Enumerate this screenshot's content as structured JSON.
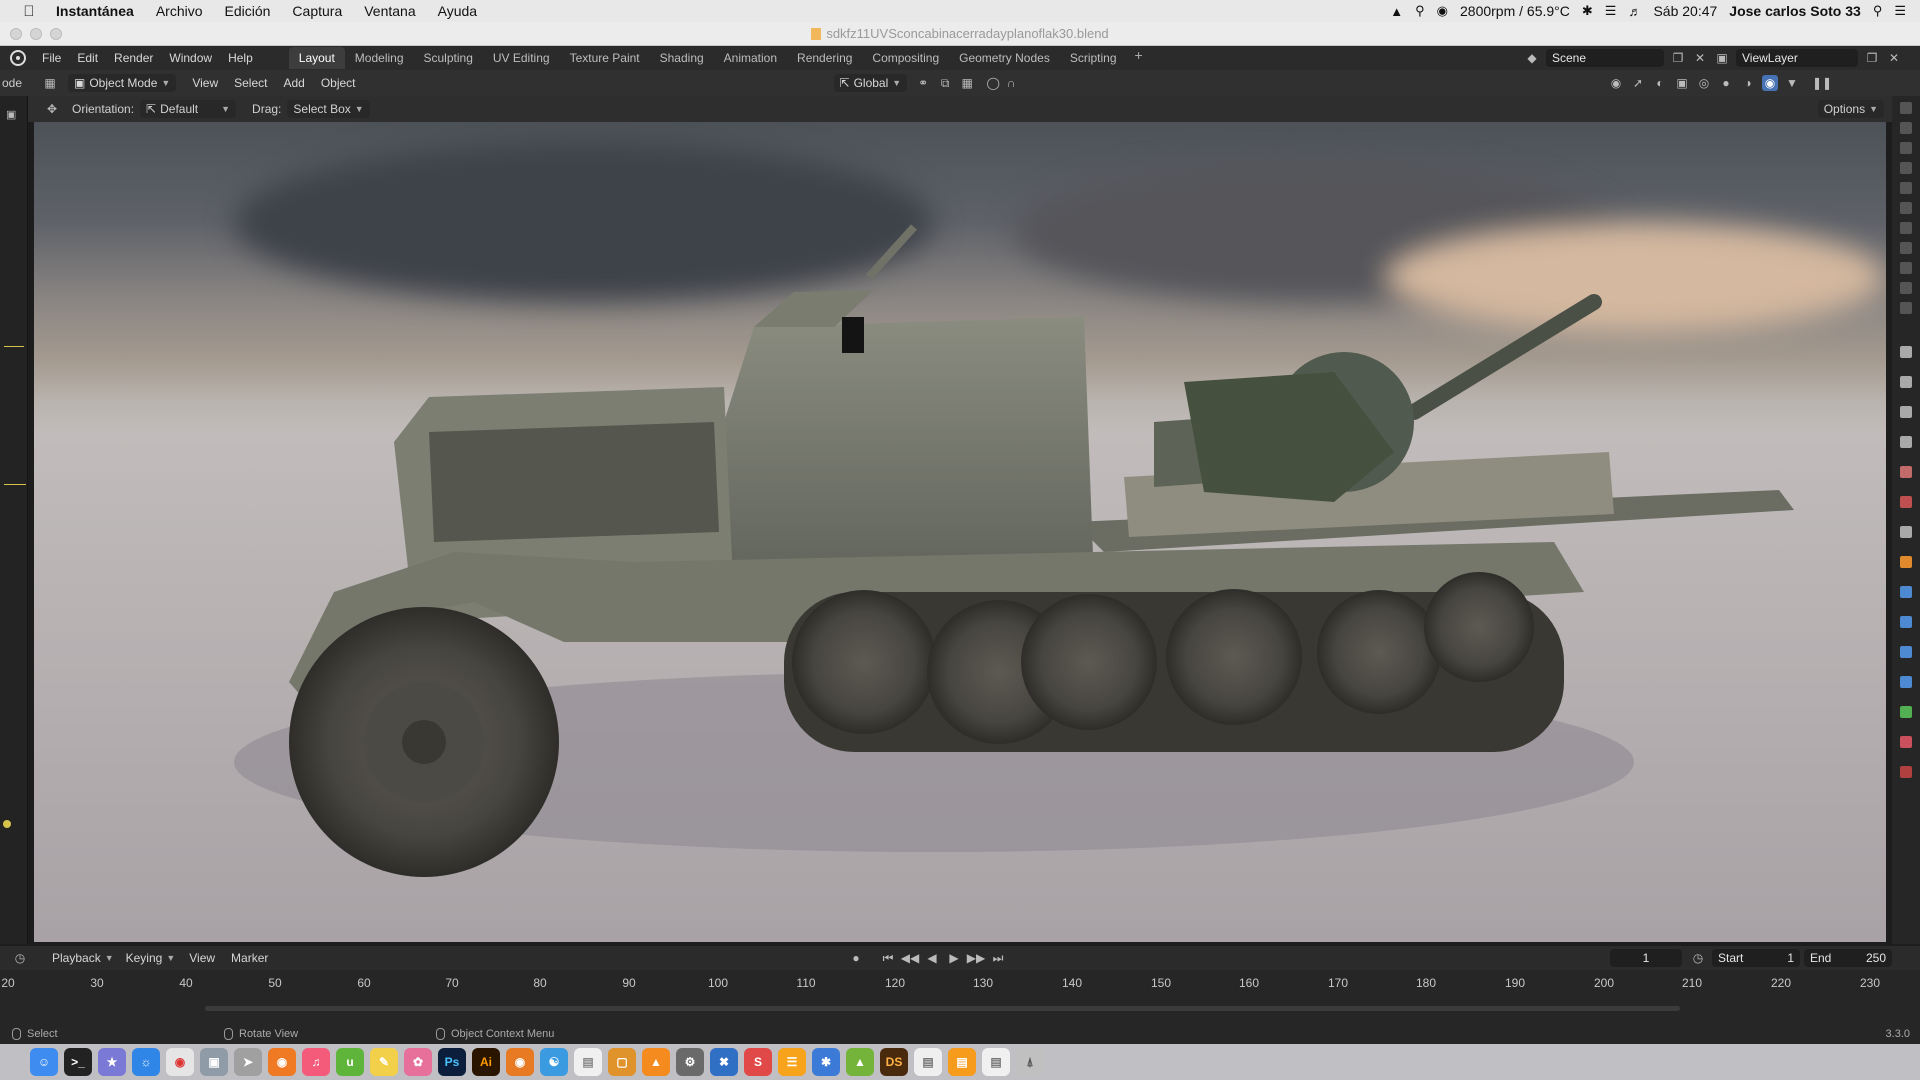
{
  "mac": {
    "app": "Instantánea",
    "menus": [
      "Archivo",
      "Edición",
      "Captura",
      "Ventana",
      "Ayuda"
    ],
    "status": "2800rpm / 65.9°C",
    "clock": "Sáb 20:47",
    "user": "Jose carlos Soto 33"
  },
  "window": {
    "title": "sdkfz11UVSconcabinacerradayplanoflak30.blend"
  },
  "topbar": {
    "menus": [
      "File",
      "Edit",
      "Render",
      "Window",
      "Help"
    ],
    "workspaces": [
      "Layout",
      "Modeling",
      "Sculpting",
      "UV Editing",
      "Texture Paint",
      "Shading",
      "Animation",
      "Rendering",
      "Compositing",
      "Geometry Nodes",
      "Scripting"
    ],
    "active_workspace": "Layout",
    "scene": "Scene",
    "view_layer": "ViewLayer"
  },
  "header": {
    "mode_prefix": "ode",
    "mode": "Object Mode",
    "menus": [
      "View",
      "Select",
      "Add",
      "Object"
    ],
    "transform": "Global"
  },
  "tool_settings": {
    "orientation_label": "Orientation:",
    "orientation": "Default",
    "drag_label": "Drag:",
    "drag": "Select Box",
    "options": "Options"
  },
  "timeline": {
    "menus": [
      "Playback",
      "Keying",
      "View",
      "Marker"
    ],
    "current_frame": "1",
    "start_label": "Start",
    "start": "1",
    "end_label": "End",
    "end": "250",
    "ticks": [
      "20",
      "30",
      "40",
      "50",
      "60",
      "70",
      "80",
      "90",
      "100",
      "110",
      "120",
      "130",
      "140",
      "150",
      "160",
      "170",
      "180",
      "190",
      "200",
      "210",
      "220",
      "230"
    ]
  },
  "status": {
    "select": "Select",
    "rotate": "Rotate View",
    "context": "Object Context Menu",
    "version": "3.3.0"
  },
  "dock": [
    "Finder",
    "Terminal",
    "Launchpad",
    "Safari",
    "Chrome",
    "Preview",
    "Rocket",
    "Firefox",
    "Music",
    "uTorrent",
    "Notes",
    "Photos",
    "Photoshop",
    "Ai",
    "Blender"
  ]
}
